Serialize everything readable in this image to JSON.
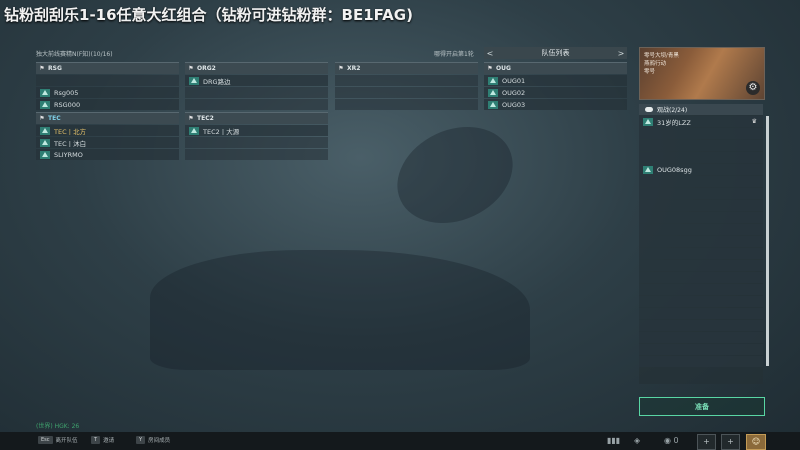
{
  "headline": "钻粉刮刮乐1-16任意大红组合（钻粉可进钻粉群：BE1FAG)",
  "room_info": "独大前线赛精N(F知)(10/16)",
  "countdown": "哪得开启第1轮",
  "team_list": {
    "title": "队伍列表",
    "prev": "<",
    "next": ">"
  },
  "teams": [
    {
      "name": "RSG",
      "members": [
        "",
        "Rsg005",
        "RSG000"
      ]
    },
    {
      "name": "ORG2",
      "members": [
        "DRG路边",
        "",
        ""
      ]
    },
    {
      "name": "XR2",
      "members": [
        "",
        "",
        ""
      ]
    },
    {
      "name": "OUG",
      "members": [
        "OUG01",
        "OUG02",
        "OUG03"
      ]
    },
    {
      "name": "TEC",
      "members": [
        "TEC丨北方",
        "TEC丨沐白",
        "SLIYRMO"
      ]
    },
    {
      "name": "TEC2",
      "members": [
        "TEC2丨大源",
        "",
        ""
      ]
    }
  ],
  "map": {
    "name": "零号大坝/青黑",
    "line2": "燕鸦行动",
    "line3": "零号"
  },
  "spectators": {
    "title": "观战(2/24)",
    "rows": [
      "31岁的LZZ",
      "",
      "",
      "",
      "OUG08sgg",
      "",
      "",
      "",
      "",
      "",
      "",
      "",
      "",
      "",
      "",
      "",
      "",
      "",
      "",
      "",
      ""
    ]
  },
  "ready_label": "准备",
  "fps_text": "(世界) HGK: 26",
  "hotkeys": [
    {
      "key": "Esc",
      "label": "离开队伍"
    },
    {
      "key": "T",
      "label": "邀请"
    },
    {
      "key": "Y",
      "label": "房间成员"
    }
  ],
  "bottom_icons": {
    "spectate_count": "0",
    "plus": "+"
  },
  "colors": {
    "ready": "#59d6a4",
    "highlight_member": "#e3c06a",
    "team_icon": "#2f7f74"
  }
}
